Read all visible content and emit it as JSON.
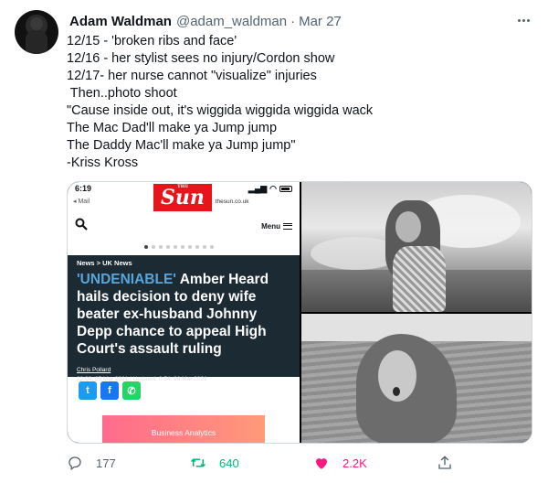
{
  "tweet": {
    "author_name": "Adam Waldman",
    "handle": "@adam_waldman",
    "separator": "·",
    "date": "Mar 27",
    "lines": [
      "12/15 - 'broken ribs and face'",
      "12/16 - her stylist sees no injury/Cordon show",
      "12/17- her nurse cannot \"visualize\" injuries",
      " Then..photo shoot",
      "\"Cause inside out, it's wiggida wiggida wiggida wack",
      "The Mac Dad'll make ya Jump jump",
      "The Daddy Mac'll make ya Jump jump\"",
      "-Kriss Kross"
    ]
  },
  "screenshot": {
    "time": "6:19",
    "back_label": "◂ Mail",
    "url": "🔒 thesun.co.uk",
    "logo_text": "Sun",
    "logo_small": "THE",
    "menu_label": "Menu",
    "breadcrumbs": "News  >  UK News",
    "headline_highlight": "'UNDENIABLE'",
    "headline_rest": " Amber Heard hails decision to deny wife beater ex-husband Johnny Depp chance to appeal High Court's assault ruling",
    "byline": "Chris Pollard",
    "dateline": "22:00, 25 Mar 2021  |  Updated: 0:54, 26 Mar 2021",
    "ad_text": "Business Analytics"
  },
  "actions": {
    "replies": "177",
    "retweets": "640",
    "likes": "2.2K"
  },
  "colors": {
    "retweet": "#00ba7c",
    "like": "#f91880",
    "muted": "#536471",
    "sun_red": "#e8141c"
  }
}
